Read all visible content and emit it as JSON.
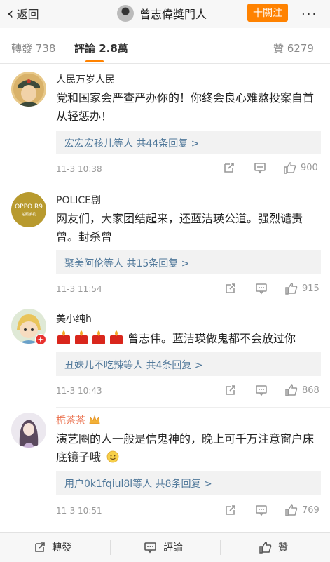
{
  "nav": {
    "back_label": "返回",
    "title": "曾志偉獎門人",
    "follow_label": "十關注",
    "more_label": "···"
  },
  "tabs": {
    "repost_label": "轉發 738",
    "comments_label": "評論 2.8萬",
    "likes_label": "贊 6279"
  },
  "comments": [
    {
      "user": "人民万岁人民",
      "text": "党和国家会严查严办你的！你终会良心难熬投案自首从轻惩办！",
      "replies": "宏宏宏孩儿等人  共44条回复 >",
      "time": "11-3 10:38",
      "likes": "900"
    },
    {
      "user": "POLICE剧",
      "text": "网友们，大家团结起来，还蓝洁瑛公道。强烈谴责曾。封杀曾",
      "replies": "聚美阿伦等人  共15条回复 >",
      "time": "11-3 11:54",
      "likes": "915",
      "avatar_text": "OPPO R9",
      "avatar_subtext": "拍照手机"
    },
    {
      "user": "美小纯h",
      "text": "曾志伟。蓝洁瑛做鬼都不会放过你",
      "replies": "丑妹儿不吃辣等人  共4条回复 >",
      "time": "11-3 10:43",
      "likes": "868"
    },
    {
      "user": "栀茶茶",
      "text": "演艺圈的人一般是信鬼神的，晚上可千万注意窗户床底镜子哦",
      "replies": "用户0k1fqiul8l等人  共8条回复 >",
      "time": "11-3 10:51",
      "likes": "769"
    }
  ],
  "bottom": {
    "repost_label": "轉發",
    "comment_label": "評論",
    "like_label": "贊"
  },
  "colors": {
    "accent": "#ff8200",
    "link": "#50789a"
  }
}
